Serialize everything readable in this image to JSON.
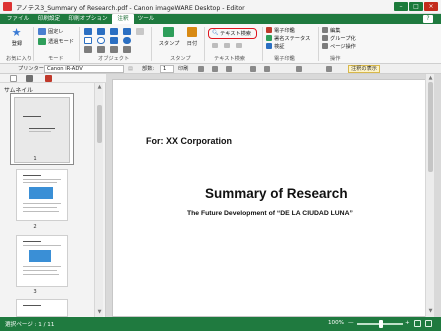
{
  "window": {
    "title": "アノテス3_Summary of Research.pdf - Canon imageWARE Desktop - Editor",
    "minimize": "–",
    "maximize": "□",
    "close": "×"
  },
  "menu": {
    "tabs": [
      "ファイル",
      "印刷設定",
      "印刷オプション",
      "注釈",
      "ツール"
    ],
    "active": "注釈",
    "help": "?"
  },
  "ribbon": {
    "favorites": {
      "button": "登録",
      "label": "お気に入り"
    },
    "mode": {
      "button": "固定レ",
      "button2": "透過モード",
      "label": "モード"
    },
    "objects": {
      "label": "オブジェクト"
    },
    "stamp": {
      "button": "スタンプ",
      "date_button": "日付",
      "label": "スタンプ"
    },
    "text_search": {
      "button": "テキスト検索",
      "label": "テキスト検索"
    },
    "e_signature": {
      "items": [
        "電子印鑑",
        "署名ステータス",
        "検証"
      ],
      "label": "電子印鑑"
    },
    "operations": {
      "items": [
        "編集",
        "グループ化",
        "ページ操作"
      ],
      "label": "操作"
    }
  },
  "toolbar": {
    "printer_label": "プリンター:",
    "printer_value": "Canon iR-ADV",
    "copies_label": "部数:",
    "copies_value": "1",
    "print_label": "印刷",
    "annotation_show": "注釈の表示"
  },
  "sidebar": {
    "title": "サムネイル",
    "pages": [
      "1",
      "2",
      "3"
    ]
  },
  "page": {
    "for_line": "For: XX Corporation",
    "title": "Summary of Research",
    "subtitle": "The Future Development of “DE LA CIUDAD LUNA”"
  },
  "status": {
    "selected_page": "選択ページ : 1 / 11",
    "zoom": "100%",
    "zoom_minus": "—",
    "zoom_plus": "+"
  },
  "colors": {
    "brand_green": "#1f7a3f",
    "highlight_red": "#e0141e"
  }
}
